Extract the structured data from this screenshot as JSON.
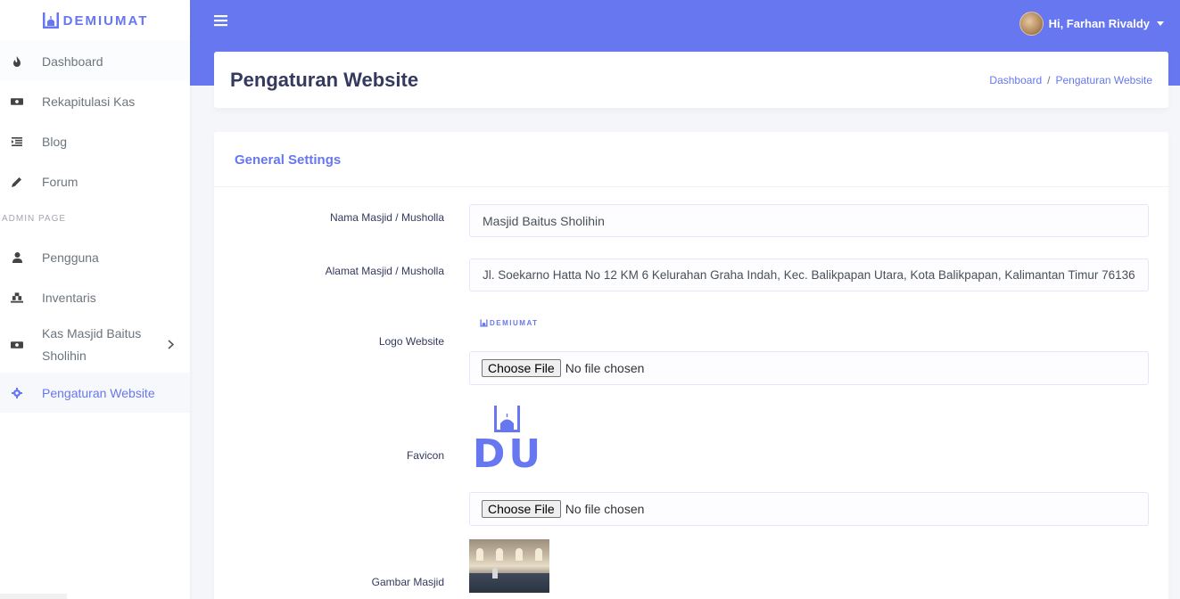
{
  "brand": {
    "name": "DEMIUMAT"
  },
  "sidebar": {
    "items": [
      {
        "label": "Dashboard",
        "icon": "fire-icon"
      },
      {
        "label": "Rekapitulasi Kas",
        "icon": "money-bill-icon"
      },
      {
        "label": "Blog",
        "icon": "list-icon"
      },
      {
        "label": "Forum",
        "icon": "pencil-icon"
      }
    ],
    "admin_header": "ADMIN PAGE",
    "admin_items": [
      {
        "label": "Pengguna",
        "icon": "user-icon"
      },
      {
        "label": "Inventaris",
        "icon": "warehouse-icon"
      },
      {
        "label": "Kas Masjid Baitus Sholihin",
        "icon": "money-bill-icon"
      },
      {
        "label": "Pengaturan Website",
        "icon": "gear-icon"
      }
    ]
  },
  "topbar": {
    "user_greeting": "Hi, Farhan Rivaldy"
  },
  "section": {
    "title": "Pengaturan Website",
    "breadcrumb": [
      "Dashboard",
      "Pengaturan Website"
    ]
  },
  "settings": {
    "card_title": "General Settings",
    "fields": {
      "name_label": "Nama Masjid / Musholla",
      "name_value": "Masjid Baitus Sholihin",
      "address_label": "Alamat Masjid / Musholla",
      "address_value": "Jl. Soekarno Hatta No 12 KM 6 Kelurahan Graha Indah, Kec. Balikpapan Utara, Kota Balikpapan, Kalimantan Timur 76136",
      "logo_label": "Logo Website",
      "favicon_label": "Favicon",
      "image_label": "Gambar Masjid"
    },
    "file_input": {
      "button": "Choose File",
      "status": "No file chosen"
    },
    "logo_text": "DEMIUMAT",
    "favicon_text": "DU"
  },
  "colors": {
    "accent": "#6777ef",
    "background": "#f4f6f9",
    "text": "#34395e"
  }
}
